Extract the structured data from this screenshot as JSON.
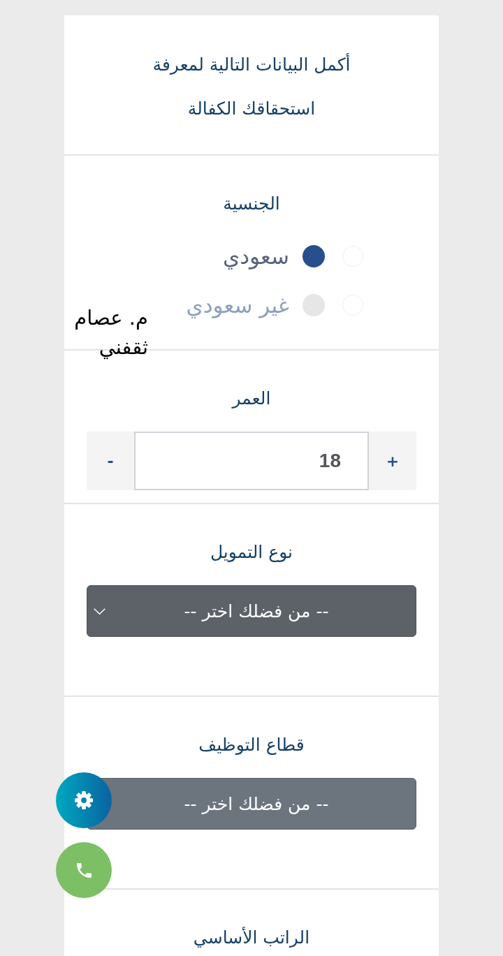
{
  "title": {
    "text": "أكمل البيانات التالية لمعرفة استحقاقك الكفالة"
  },
  "sections": [
    {
      "kind": "radio",
      "label": "الجنسية",
      "options": [
        {
          "label": "سعودي",
          "selected": true
        },
        {
          "label": "غير سعودي",
          "selected": false
        }
      ]
    },
    {
      "kind": "stepper",
      "label": "العمر",
      "increment": "+",
      "value": "18",
      "decrement": "-"
    },
    {
      "kind": "select",
      "label": "نوع التمويل",
      "value": "-- من فضلك اختر --",
      "focused": true
    },
    {
      "kind": "select",
      "label": "قطاع التوظيف",
      "value": "-- من فضلك اختر --",
      "focused": false
    },
    {
      "kind": "label",
      "label": "الراتب الأساسي"
    }
  ],
  "floating_buttons": [
    {
      "kind": "settings"
    },
    {
      "kind": "call"
    }
  ],
  "overlay_note": "م. عصام ثقفني"
}
